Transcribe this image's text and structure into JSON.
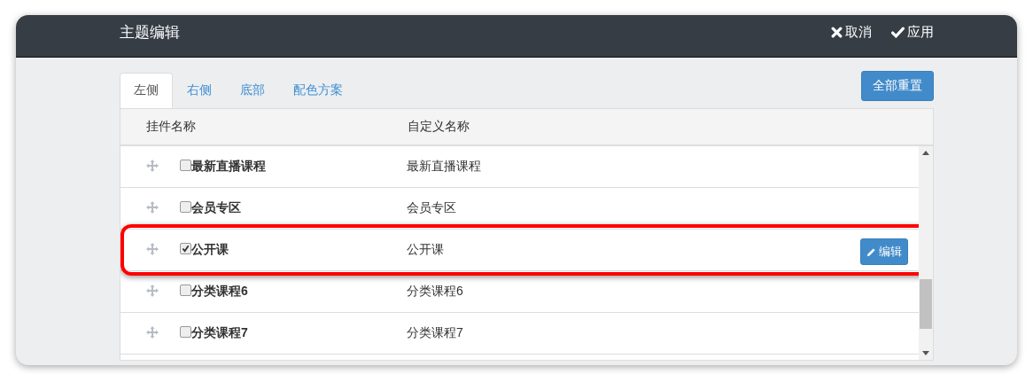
{
  "window": {
    "title": "主题编辑",
    "actions": [
      {
        "kind": "cancel",
        "label": "取消"
      },
      {
        "kind": "apply",
        "label": "应用"
      }
    ]
  },
  "tabs": [
    {
      "label": "左侧",
      "selected": true
    },
    {
      "label": "右侧",
      "selected": false
    },
    {
      "label": "底部",
      "selected": false
    },
    {
      "label": "配色方案",
      "selected": false
    }
  ],
  "reset_button": "全部重置",
  "table": {
    "columns": [
      "挂件名称",
      "自定义名称"
    ],
    "rows": [
      {
        "name": "最新直播课程",
        "custom_name": "最新直播课程",
        "checked": false,
        "highlighted": false
      },
      {
        "name": "会员专区",
        "custom_name": "会员专区",
        "checked": false,
        "highlighted": false
      },
      {
        "name": "公开课",
        "custom_name": "公开课",
        "checked": true,
        "highlighted": true,
        "edit_button": "编辑"
      },
      {
        "name": "分类课程6",
        "custom_name": "分类课程6",
        "checked": false,
        "highlighted": false
      },
      {
        "name": "分类课程7",
        "custom_name": "分类课程7",
        "checked": false,
        "highlighted": false
      }
    ]
  }
}
